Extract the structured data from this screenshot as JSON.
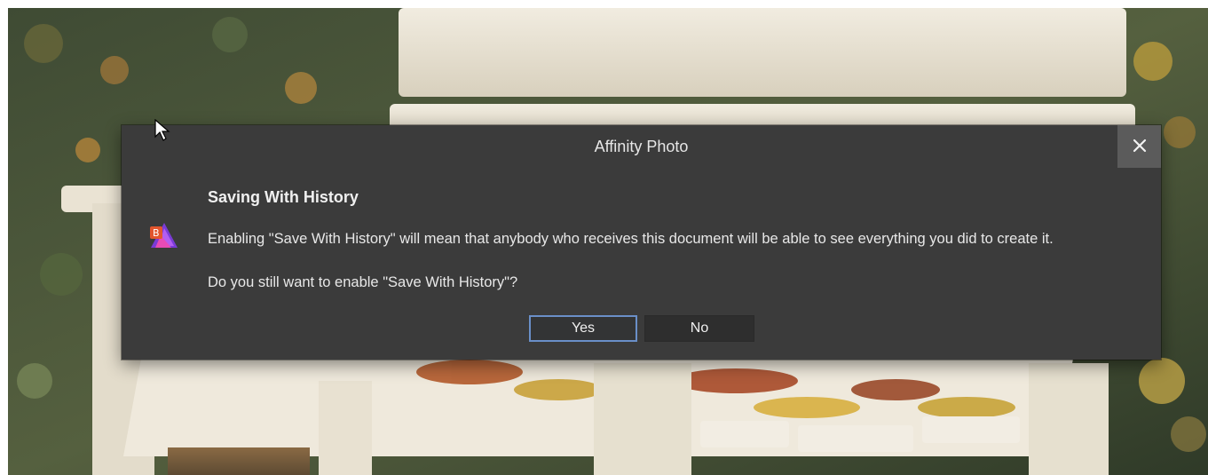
{
  "dialog": {
    "title": "Affinity Photo",
    "heading": "Saving With History",
    "message": "Enabling \"Save With History\" will mean that anybody who receives this document will be able to see everything you did to create it.",
    "question": "Do you still want to enable \"Save With History\"?",
    "buttons": {
      "yes": "Yes",
      "no": "No"
    },
    "close_icon": "close-icon",
    "app_icon": "affinity-photo-icon",
    "colors": {
      "dialog_bg": "#3b3b3b",
      "close_bg": "#5b5b5b",
      "focus_border": "#6a8fc8",
      "button_bg": "#2e2e2e"
    }
  },
  "background": {
    "description_icon": "park-bench-photo"
  }
}
